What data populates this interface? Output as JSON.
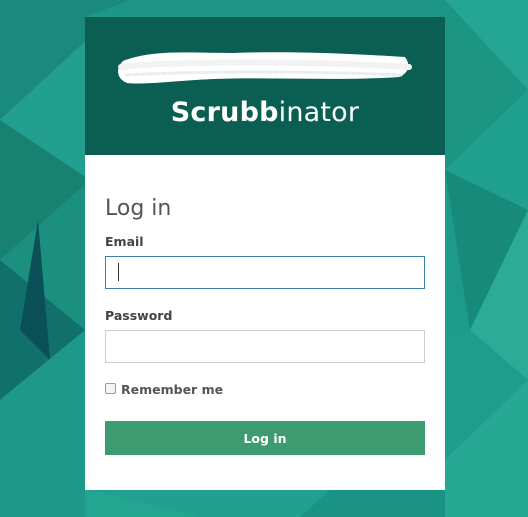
{
  "colors": {
    "background": "#1e9a8a",
    "header": "#0a5f52",
    "card": "#ffffff",
    "button": "#3c9b71",
    "focus_border": "#3e7fa8"
  },
  "header": {
    "logo_icon": "redacted-scribble-logo",
    "brand_bold": "Scrubb",
    "brand_rest": "inator"
  },
  "form": {
    "heading": "Log in",
    "email_label": "Email",
    "email_value": "",
    "password_label": "Password",
    "password_value": "",
    "remember_label": "Remember me",
    "remember_checked": false,
    "submit_label": "Log in"
  }
}
